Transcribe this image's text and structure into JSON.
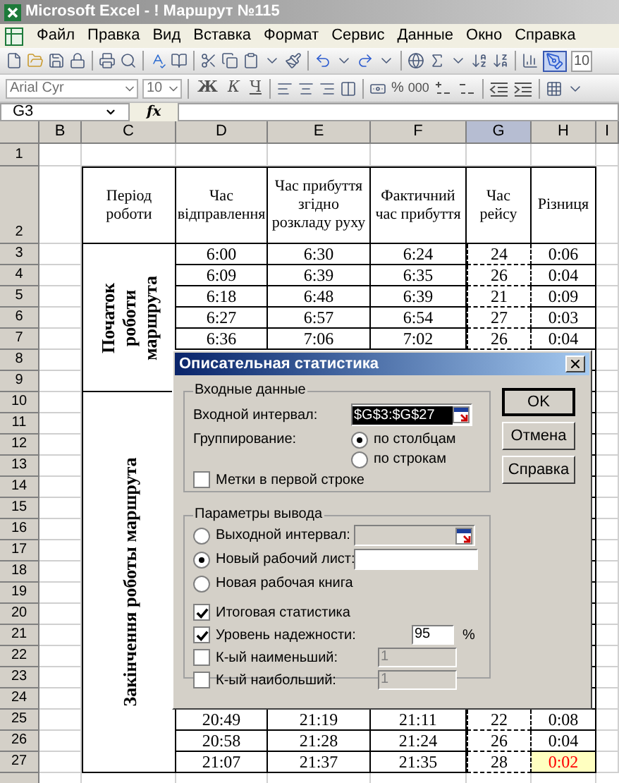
{
  "window": {
    "title": "Microsoft Excel - ! Маршрут №115"
  },
  "menu": [
    "Файл",
    "Правка",
    "Вид",
    "Вставка",
    "Формат",
    "Сервис",
    "Данные",
    "Окно",
    "Справка"
  ],
  "standard_toolbar": {
    "zoom": "10"
  },
  "format_toolbar": {
    "font": "Arial Cyr",
    "size": "10",
    "styles": [
      "Ж",
      "К",
      "Ч"
    ],
    "percent": "%",
    "thousands": "000"
  },
  "formula_bar": {
    "name_box": "G3",
    "fx": "fx"
  },
  "sheet": {
    "columns": [
      {
        "label": "B",
        "selected": false
      },
      {
        "label": "C",
        "selected": false
      },
      {
        "label": "D",
        "selected": false
      },
      {
        "label": "E",
        "selected": false
      },
      {
        "label": "F",
        "selected": false
      },
      {
        "label": "G",
        "selected": true
      },
      {
        "label": "H",
        "selected": false
      },
      {
        "label": "I",
        "selected": false
      }
    ],
    "blank_row": {
      "number": "1"
    },
    "header_row": {
      "number": "2",
      "cells": [
        "Період роботи",
        "Час відправлення",
        "Час прибуття згідно розкладу руху",
        "Фактичний час прибуття",
        "Час рейсу",
        "Різниця"
      ]
    },
    "groups": [
      {
        "label": "Початок роботи маршрута",
        "rows": [
          {
            "number": "3",
            "cells": [
              "6:00",
              "6:30",
              "6:24",
              "24",
              "0:06"
            ],
            "alert": false
          },
          {
            "number": "4",
            "cells": [
              "6:09",
              "6:39",
              "6:35",
              "26",
              "0:04"
            ],
            "alert": false
          },
          {
            "number": "5",
            "cells": [
              "6:18",
              "6:48",
              "6:39",
              "21",
              "0:09"
            ],
            "alert": false
          },
          {
            "number": "6",
            "cells": [
              "6:27",
              "6:57",
              "6:54",
              "27",
              "0:03"
            ],
            "alert": false
          },
          {
            "number": "7",
            "cells": [
              "6:36",
              "7:06",
              "7:02",
              "26",
              "0:04"
            ],
            "alert": false
          },
          {
            "number": "8"
          },
          {
            "number": "9"
          }
        ]
      },
      {
        "label": "Закінчення роботы маршрута",
        "rows": [
          {
            "number": "10"
          },
          {
            "number": "11"
          },
          {
            "number": "12"
          },
          {
            "number": "13"
          },
          {
            "number": "14"
          },
          {
            "number": "15"
          },
          {
            "number": "16"
          },
          {
            "number": "17"
          },
          {
            "number": "18"
          },
          {
            "number": "19"
          },
          {
            "number": "20"
          },
          {
            "number": "21"
          },
          {
            "number": "22"
          },
          {
            "number": "23"
          },
          {
            "number": "24"
          },
          {
            "number": "25",
            "cells": [
              "20:49",
              "21:19",
              "21:11",
              "22",
              "0:08"
            ],
            "alert": false
          },
          {
            "number": "26",
            "cells": [
              "20:58",
              "21:28",
              "21:24",
              "26",
              "0:04"
            ],
            "alert": false
          },
          {
            "number": "27",
            "cells": [
              "21:07",
              "21:37",
              "21:35",
              "28",
              "0:02"
            ],
            "alert": true
          }
        ]
      }
    ]
  },
  "dialog": {
    "title": "Описательная статистика",
    "input_group": {
      "legend": "Входные данные",
      "input_range": {
        "label": "Входной интервал:",
        "value": "$G$3:$G$27",
        "value_selected": true
      },
      "grouping": {
        "label": "Группирование:",
        "options": [
          {
            "label": "по столбцам",
            "selected": true
          },
          {
            "label": "по строкам",
            "selected": false
          }
        ]
      },
      "labels_first_row": {
        "label": "Метки в первой строке",
        "checked": false
      }
    },
    "output_group": {
      "legend": "Параметры вывода",
      "destinations": [
        {
          "label": "Выходной интервал:",
          "selected": false,
          "kind": "range"
        },
        {
          "label": "Новый рабочий лист:",
          "selected": true,
          "kind": "field"
        },
        {
          "label": "Новая рабочая книга",
          "selected": false,
          "kind": "none"
        }
      ],
      "options": [
        {
          "label": "Итоговая статистика",
          "checked": true
        },
        {
          "label": "Уровень надежности:",
          "checked": true,
          "value": "95",
          "unit": "%"
        },
        {
          "label": "К-ый наименьший:",
          "checked": false,
          "value": "1"
        },
        {
          "label": "К-ый наибольший:",
          "checked": false,
          "value": "1"
        }
      ]
    },
    "buttons": [
      {
        "label": "OK",
        "default": true
      },
      {
        "label": "Отмена",
        "default": false
      },
      {
        "label": "Справка",
        "default": false
      }
    ]
  }
}
